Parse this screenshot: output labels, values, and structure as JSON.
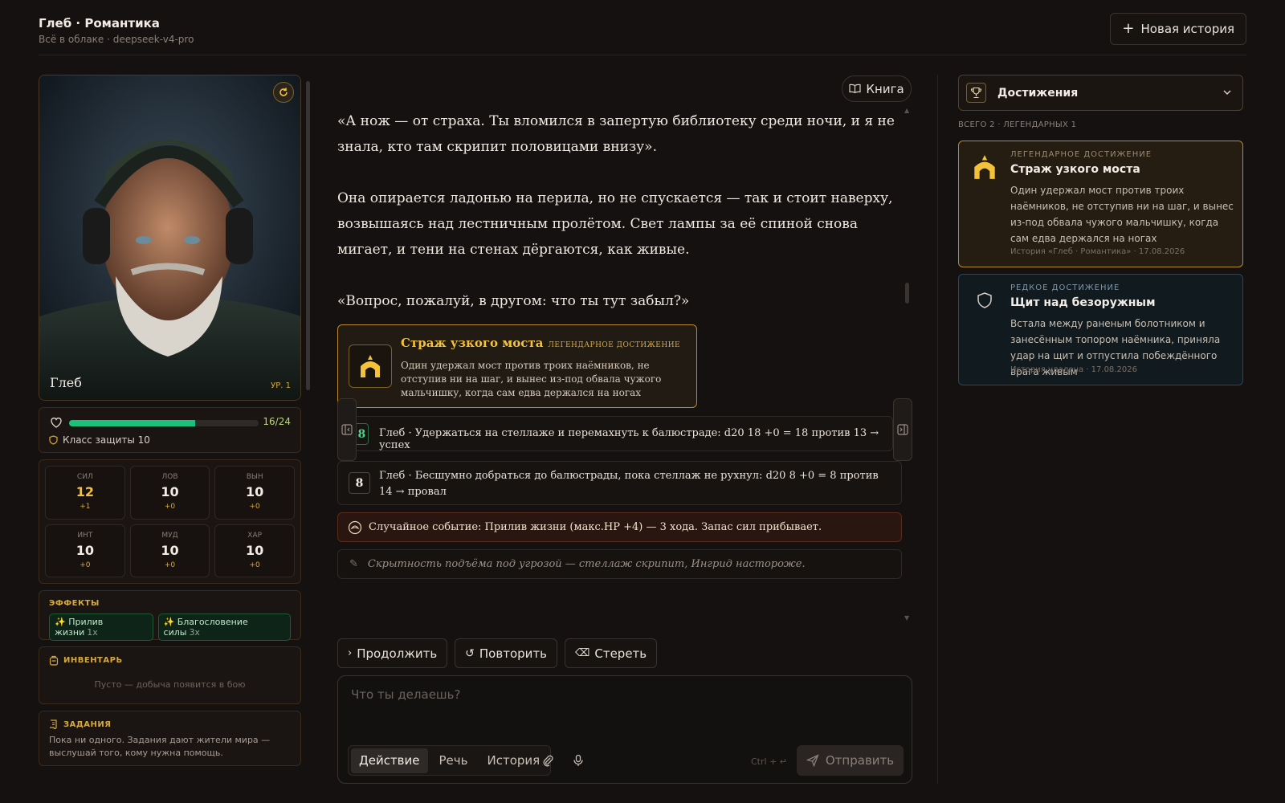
{
  "header": {
    "title": "Глеб · Романтика",
    "subtitle": "Всё в облаке · deepseek-v4-pro",
    "new_story": "Новая история"
  },
  "character": {
    "name": "Глеб",
    "level": "УР. 1",
    "hp": "16/24",
    "hp_fraction": 0.667,
    "armor_class": "Класс защиты 10",
    "stats": [
      {
        "label": "СИЛ",
        "value": "12",
        "mod": "+1"
      },
      {
        "label": "ЛОВ",
        "value": "10",
        "mod": "+0"
      },
      {
        "label": "ВЫН",
        "value": "10",
        "mod": "+0"
      },
      {
        "label": "ИНТ",
        "value": "10",
        "mod": "+0"
      },
      {
        "label": "МУД",
        "value": "10",
        "mod": "+0"
      },
      {
        "label": "ХАР",
        "value": "10",
        "mod": "+0"
      }
    ],
    "effects_title": "ЭФФЕКТЫ",
    "effects": [
      {
        "name": "Прилив жизни",
        "count": "1x"
      },
      {
        "name": "Благословение силы",
        "count": "3x"
      }
    ],
    "inventory_title": "ИНВЕНТАРЬ",
    "inventory_empty": "Пусто — добыча появится в бою",
    "quests_title": "ЗАДАНИЯ",
    "quests_empty": "Пока ни одного. Задания дают жители мира — выслушай того, кому нужна помощь."
  },
  "story": {
    "book_button": "Книга",
    "paragraphs": [
      "«А нож — от страха. Ты вломился в запертую библиотеку среди ночи, и я не знала, кто там скрипит половицами внизу».",
      "Она опирается ладонью на перила, но не спускается — так и стоит наверху, возвышаясь над лестничным пролётом. Свет лампы за её спиной снова мигает, и тени на стенах дёргаются, как живые.",
      "«Вопрос, пожалуй, в другом: что ты тут забыл?»"
    ],
    "achievement_toast": {
      "title": "Страж узкого моста",
      "tag": "ЛЕГЕНДАРНОЕ ДОСТИЖЕНИЕ",
      "desc": "Один удержал мост против троих наёмников, не отступив ни на шаг, и вынес из-под обвала чужого мальчишку, когда сам едва держался на ногах"
    },
    "rolls": [
      {
        "die": "18",
        "text": "Глеб · Удержаться на стеллаже и перемахнуть к балюстраде: d20 18 +0 = 18 против 13 → успех"
      },
      {
        "die": "8",
        "text": "Глеб · Бесшумно добраться до балюстрады, пока стеллаж не рухнул: d20 8 +0 = 8 против 14 → провал"
      }
    ],
    "event": "Случайное событие: Прилив жизни (макс.HP +4) — 3 хода. Запас сил прибывает.",
    "hint": "Скрытность подъёма под угрозой — стеллаж скрипит, Ингрид настороже."
  },
  "actions": {
    "continue": "Продолжить",
    "retry": "Повторить",
    "erase": "Стереть"
  },
  "composer": {
    "placeholder": "Что ты делаешь?",
    "modes": [
      "Действие",
      "Речь",
      "История"
    ],
    "active_mode": "Действие",
    "shortcut": "Ctrl + ↵",
    "send": "Отправить"
  },
  "achievements": {
    "title": "Достижения",
    "count": "ВСЕГО 2 · ЛЕГЕНДАРНЫХ 1",
    "items": [
      {
        "kind": "ЛЕГЕНДАРНОЕ ДОСТИЖЕНИЕ",
        "name": "Страж узкого моста",
        "desc": "Один удержал мост против троих наёмников, не отступив ни на шаг, и вынес из-под обвала чужого мальчишку, когда сам едва держался на ногах",
        "meta": "История «Глеб · Романтика» · 17.08.2026"
      },
      {
        "kind": "РЕДКОЕ ДОСТИЖЕНИЕ",
        "name": "Щит над безоружным",
        "desc": "Встала между раненым болотником и занесённым топором наёмника, приняла удар на щит и отпустила побеждённого врага живым",
        "meta": "История удалена · 17.08.2026"
      }
    ]
  },
  "colors": {
    "accent_gold": "#f3c13a",
    "hp_green": "#1cc07a",
    "rare_blue": "#1d4a66"
  }
}
